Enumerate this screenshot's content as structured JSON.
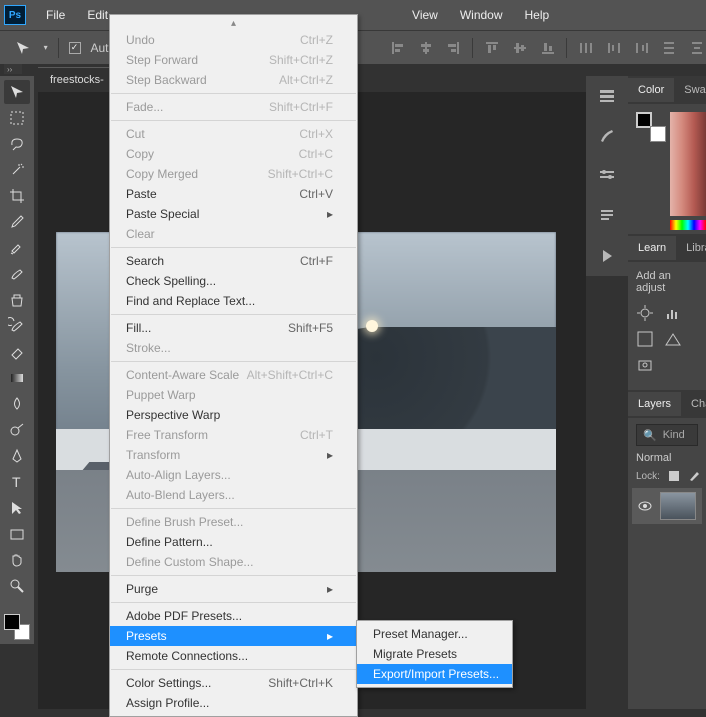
{
  "app": {
    "logo": "Ps"
  },
  "menubar": [
    "File",
    "Edit",
    "View",
    "Window",
    "Help"
  ],
  "optionsbar": {
    "auto_label": "Auto-"
  },
  "doc_tab": "freestocks-",
  "edit_menu": {
    "groups": [
      [
        {
          "label": "Undo",
          "shortcut": "Ctrl+Z",
          "disabled": true
        },
        {
          "label": "Step Forward",
          "shortcut": "Shift+Ctrl+Z",
          "disabled": true
        },
        {
          "label": "Step Backward",
          "shortcut": "Alt+Ctrl+Z",
          "disabled": true
        }
      ],
      [
        {
          "label": "Fade...",
          "shortcut": "Shift+Ctrl+F",
          "disabled": true
        }
      ],
      [
        {
          "label": "Cut",
          "shortcut": "Ctrl+X",
          "disabled": true
        },
        {
          "label": "Copy",
          "shortcut": "Ctrl+C",
          "disabled": true
        },
        {
          "label": "Copy Merged",
          "shortcut": "Shift+Ctrl+C",
          "disabled": true
        },
        {
          "label": "Paste",
          "shortcut": "Ctrl+V"
        },
        {
          "label": "Paste Special",
          "submenu": true
        },
        {
          "label": "Clear",
          "disabled": true
        }
      ],
      [
        {
          "label": "Search",
          "shortcut": "Ctrl+F"
        },
        {
          "label": "Check Spelling..."
        },
        {
          "label": "Find and Replace Text..."
        }
      ],
      [
        {
          "label": "Fill...",
          "shortcut": "Shift+F5"
        },
        {
          "label": "Stroke...",
          "disabled": true
        }
      ],
      [
        {
          "label": "Content-Aware Scale",
          "shortcut": "Alt+Shift+Ctrl+C",
          "disabled": true
        },
        {
          "label": "Puppet Warp",
          "disabled": true
        },
        {
          "label": "Perspective Warp"
        },
        {
          "label": "Free Transform",
          "shortcut": "Ctrl+T",
          "disabled": true
        },
        {
          "label": "Transform",
          "submenu": true,
          "disabled": true
        },
        {
          "label": "Auto-Align Layers...",
          "disabled": true
        },
        {
          "label": "Auto-Blend Layers...",
          "disabled": true
        }
      ],
      [
        {
          "label": "Define Brush Preset...",
          "disabled": true
        },
        {
          "label": "Define Pattern..."
        },
        {
          "label": "Define Custom Shape...",
          "disabled": true
        }
      ],
      [
        {
          "label": "Purge",
          "submenu": true
        }
      ],
      [
        {
          "label": "Adobe PDF Presets..."
        },
        {
          "label": "Presets",
          "submenu": true,
          "highlight": true
        },
        {
          "label": "Remote Connections..."
        }
      ],
      [
        {
          "label": "Color Settings...",
          "shortcut": "Shift+Ctrl+K"
        },
        {
          "label": "Assign Profile..."
        }
      ]
    ]
  },
  "presets_submenu": [
    {
      "label": "Preset Manager..."
    },
    {
      "label": "Migrate Presets"
    },
    {
      "label": "Export/Import Presets...",
      "highlight": true
    }
  ],
  "panels": {
    "color_tabs": [
      "Color",
      "Swa"
    ],
    "learn_tabs": [
      "Learn",
      "Libra"
    ],
    "adjust_label": "Add an adjust",
    "layers_tabs": [
      "Layers",
      "Cha"
    ],
    "layers": {
      "kind_placeholder": "Kind",
      "blend_mode": "Normal",
      "lock_label": "Lock:"
    }
  },
  "tools": [
    "move",
    "marquee",
    "lasso",
    "magic-wand",
    "crop",
    "eyedropper",
    "healing",
    "brush",
    "clone",
    "history-brush",
    "eraser",
    "gradient",
    "blur",
    "dodge",
    "pen",
    "type",
    "path-select",
    "rectangle",
    "hand",
    "zoom"
  ]
}
